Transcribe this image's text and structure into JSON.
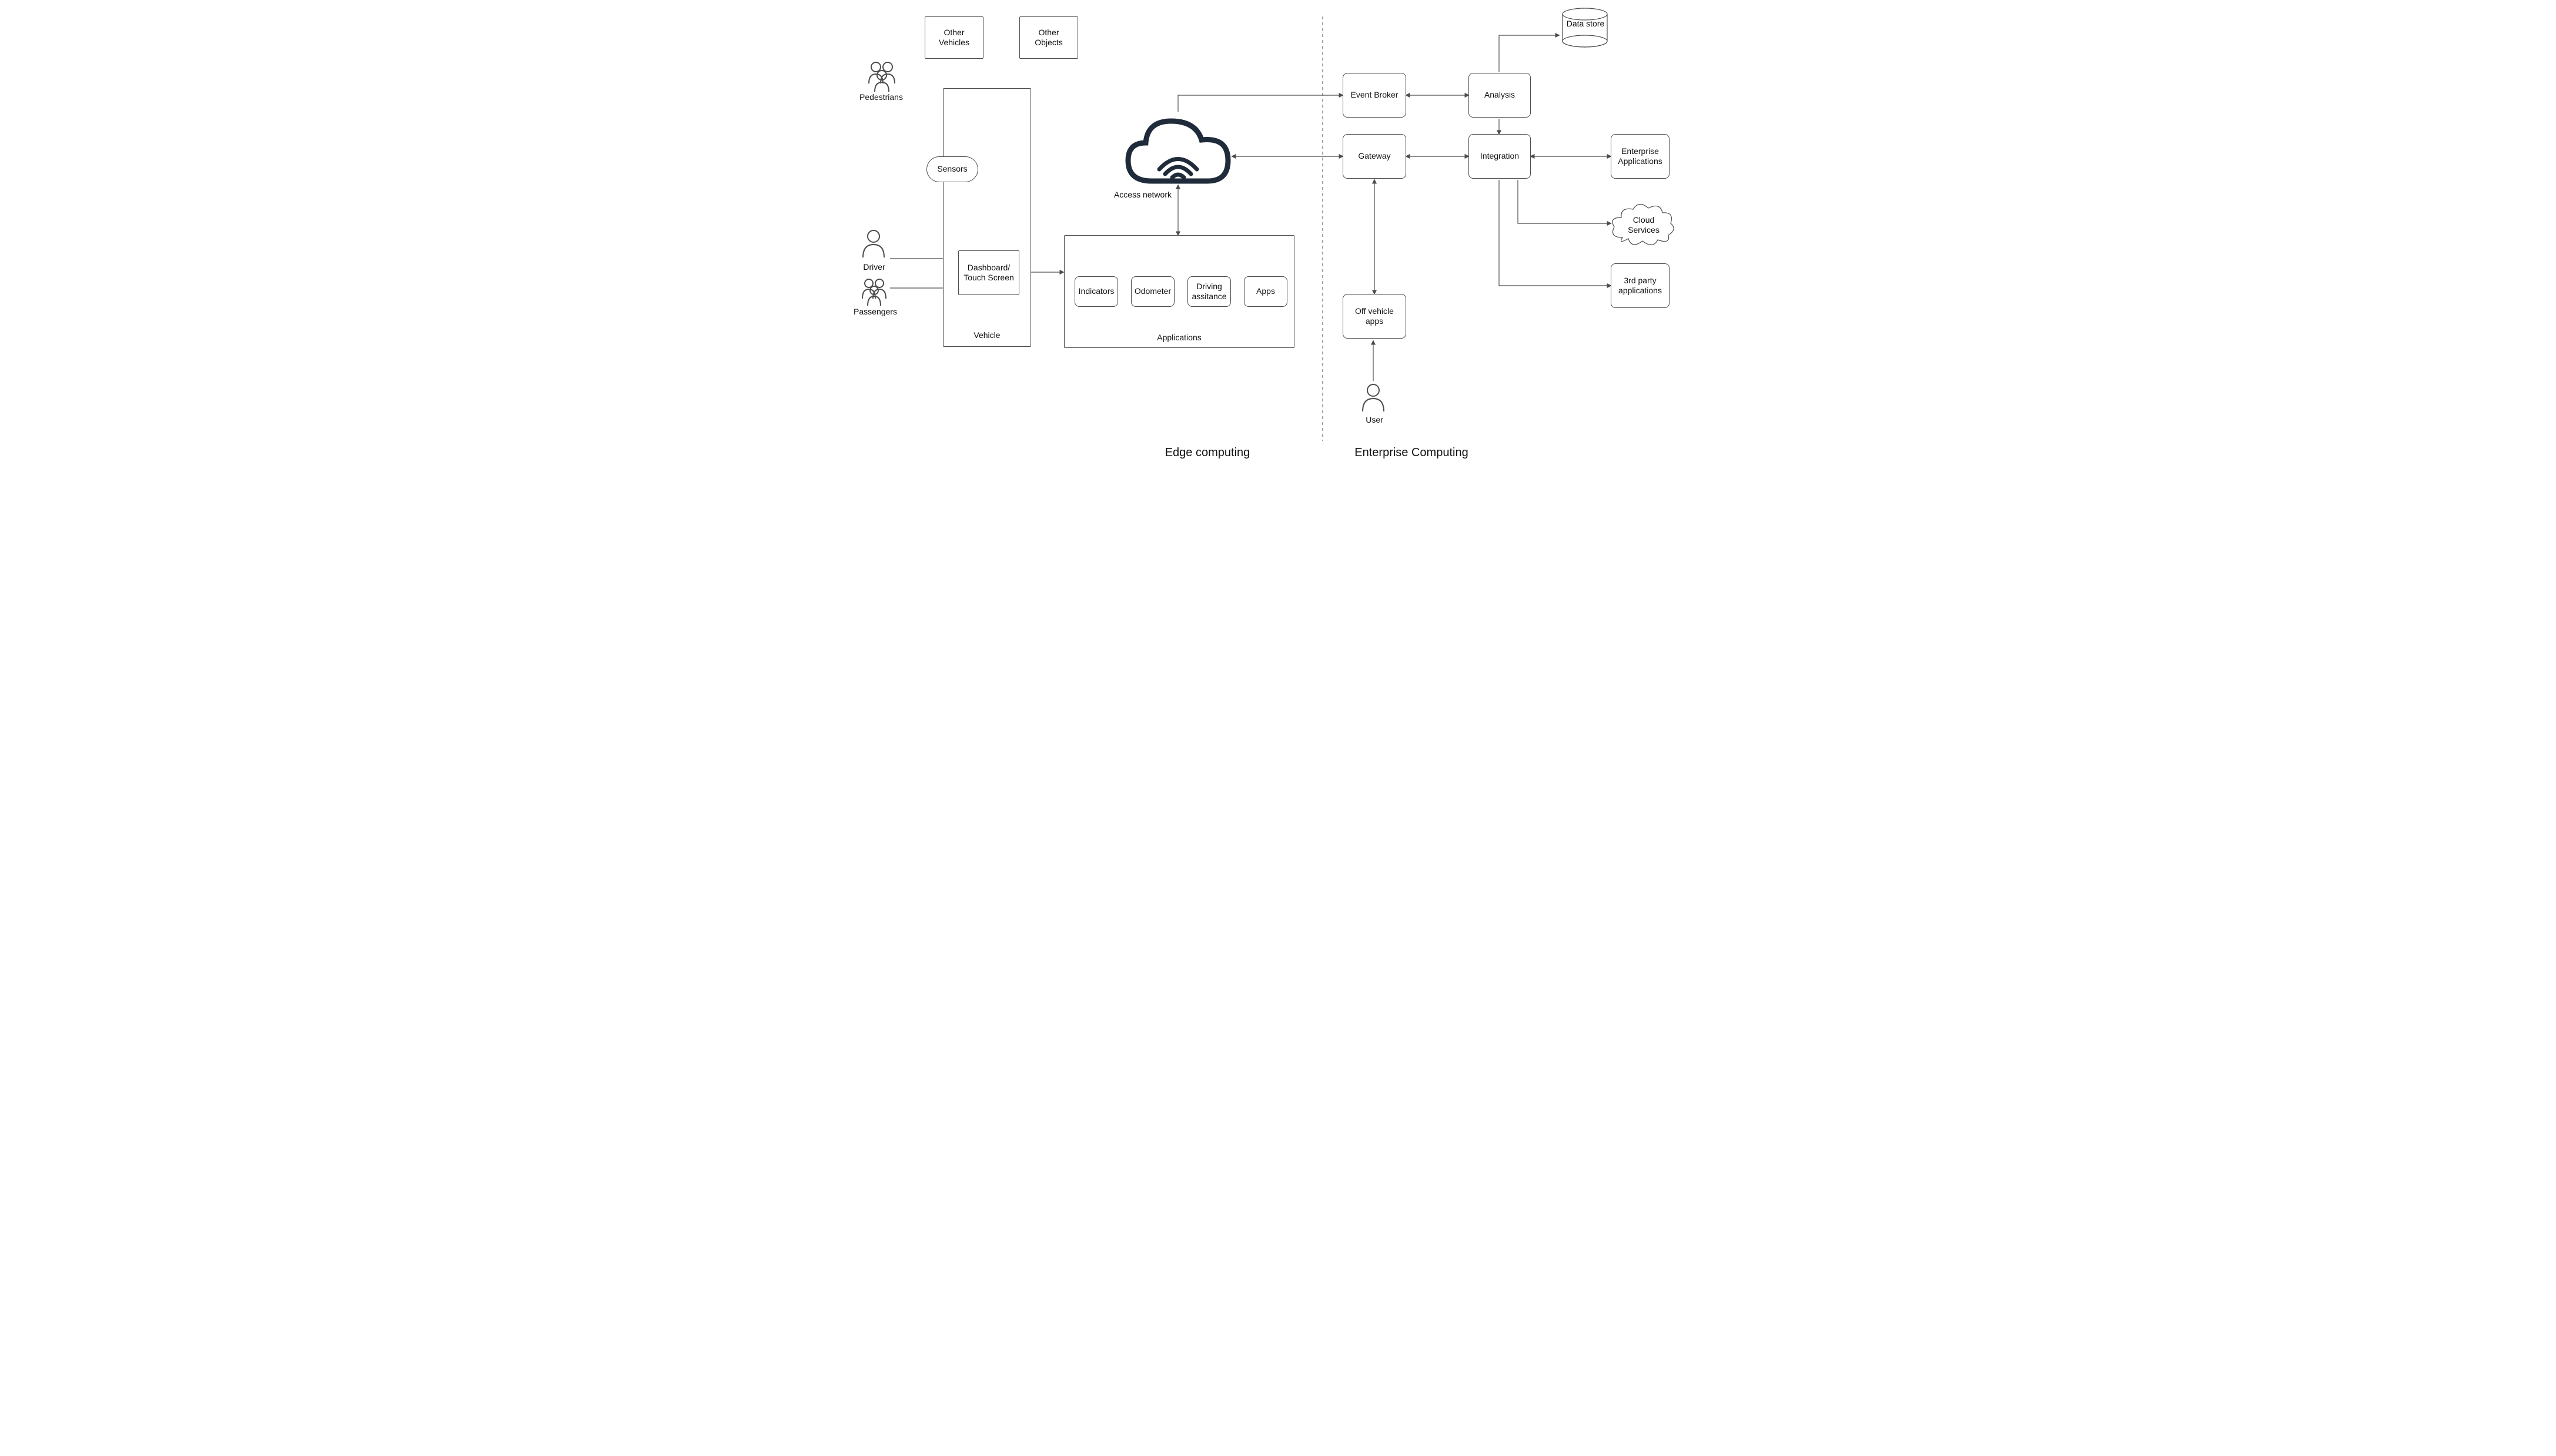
{
  "nodes": {
    "other_vehicles": "Other\nVehicles",
    "other_objects": "Other\nObjects",
    "pedestrians": "Pedestrians",
    "sensors": "Sensors",
    "driver": "Driver",
    "passengers": "Passengers",
    "dashboard": "Dashboard/\nTouch Screen",
    "vehicle": "Vehicle",
    "access_network": "Access network",
    "applications_container": "Applications",
    "indicators": "Indicators",
    "odometer": "Odometer",
    "driving_assistance": "Driving\nassitance",
    "apps": "Apps",
    "event_broker": "Event Broker",
    "gateway": "Gateway",
    "off_vehicle_apps": "Off vehicle\napps",
    "user": "User",
    "analysis": "Analysis",
    "integration": "Integration",
    "data_store": "Data store",
    "enterprise_applications": "Enterprise\nApplications",
    "cloud_services": "Cloud\nServices",
    "third_party": "3rd party\napplications"
  },
  "sections": {
    "edge": "Edge computing",
    "enterprise": "Enterprise Computing"
  }
}
